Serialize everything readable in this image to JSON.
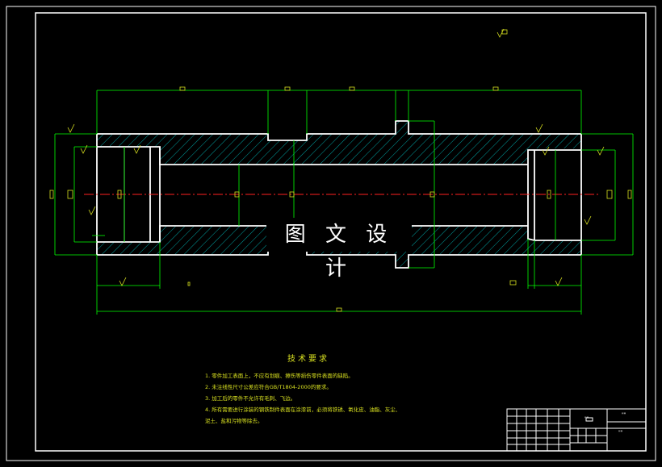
{
  "drawing": {
    "watermark": "图 文 设 计",
    "technical_requirements": {
      "title": "技术要求",
      "items": [
        "1. 零件加工表面上，不应有划痕、擦伤等损伤零件表面的缺陷。",
        "2. 未注线性尺寸公差应符合GB/T1804-2000的要求。",
        "3. 加工后的零件不允许有毛刺、飞边。",
        "4. 所有需要进行涂装的钢铁制件表面在涂漆前，必须将铁锈、氧化皮、油脂、灰尘、",
        "泥土、盐和污物等除去。"
      ]
    },
    "title_block": {
      "label_a": "\"\"",
      "label_b": "\"\"",
      "label_c": "\"\""
    },
    "colors": {
      "frame": "#ffffff",
      "dimension": "#00ff00",
      "hatch": "#00c8c8",
      "centerline": "#ff2020",
      "text": "#d8e020"
    }
  }
}
